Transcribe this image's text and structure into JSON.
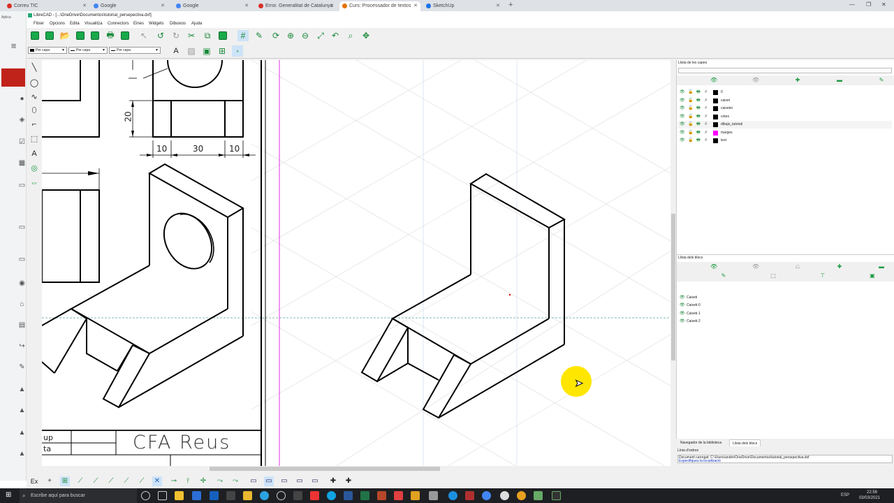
{
  "browser": {
    "tabs": [
      {
        "label": "Correu TIC",
        "color": "#d93025"
      },
      {
        "label": "Google",
        "color": "#4285f4"
      },
      {
        "label": "Google",
        "color": "#4285f4"
      },
      {
        "label": "Error. Generalitat de Catalunya",
        "color": "#d93025"
      },
      {
        "label": "Curs: Processador de textos",
        "color": "#e37400"
      },
      {
        "label": "SketchUp",
        "color": "#1a73e8"
      }
    ],
    "new_tab": "+",
    "apps_label": "Aplica"
  },
  "librecad": {
    "title": "LibreCAD - [...\\OneDrive\\Documentos\\tutorial_persepectiva.dxf]",
    "menus": [
      "Fitxer",
      "Opcions",
      "Edita",
      "Visualitza",
      "Connectors",
      "Eines",
      "Widgets",
      "Dibuixos",
      "Ajuda"
    ],
    "pen": {
      "color": "Per capa",
      "width": "Per capa",
      "type": "Per capa"
    },
    "layers_title": "Llista de les capes",
    "layers": [
      {
        "name": "0",
        "color": "#000000"
      },
      {
        "name": "caixet",
        "color": "#000000"
      },
      {
        "name": "caixetei",
        "color": "#000000"
      },
      {
        "name": "cotes",
        "color": "#000000"
      },
      {
        "name": "dibujo_tutorial",
        "color": "#000000",
        "active": true
      },
      {
        "name": "marges",
        "color": "#ff00ff"
      },
      {
        "name": "text",
        "color": "#000000"
      }
    ],
    "blocks_title": "Llista dels blocs",
    "blocks": [
      "Caixeti",
      "Caixeti-0",
      "Caixeti-1",
      "Caixeti-2"
    ],
    "dock_tabs": [
      "Navegador de la biblioteca",
      "Llista dels blocs"
    ],
    "command": {
      "title": "Línia d'ordres",
      "line1": "Document carregat: C:\\Users\\andre\\OneDrive\\Documentos\\tutorial_persepectiva.dxf",
      "line2": "Especifiqueu la localització"
    },
    "drawing": {
      "dim_20": "20",
      "dim_10a": "10",
      "dim_30": "30",
      "dim_10b": "10",
      "title_block": "CFA Reus",
      "tb_row1": "up",
      "tb_row2": "ta"
    },
    "snap_prefix": "Ex"
  },
  "taskbar": {
    "search_placeholder": "Escribe aquí para buscar",
    "lang": "ESP",
    "time": "22:56",
    "date": "03/03/2021"
  }
}
